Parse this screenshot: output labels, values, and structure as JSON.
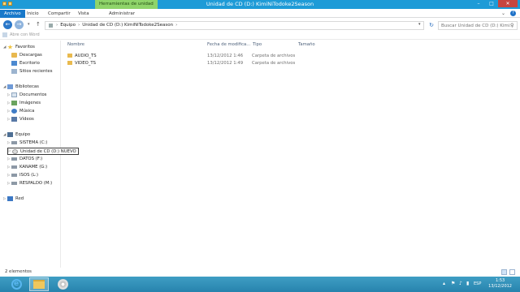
{
  "window": {
    "title": "Unidad de CD (D:) KimiNiTodoke2Season",
    "context_tab": "Herramientas de unidad"
  },
  "ribbon": {
    "tabs": [
      {
        "label": "Archivo",
        "active": true
      },
      {
        "label": "Inicio",
        "active": false
      },
      {
        "label": "Compartir",
        "active": false
      },
      {
        "label": "Vista",
        "active": false
      },
      {
        "label": "Administrar",
        "active": false
      }
    ]
  },
  "address": {
    "crumbs": [
      "Equipo",
      "Unidad de CD (D:) KimiNiTodoke2Season"
    ],
    "search_placeholder": "Buscar Unidad de CD (D:) Kimi..."
  },
  "command_strip": {
    "open_with": "Abre con Word"
  },
  "nav_pane": {
    "favorites": {
      "label": "Favoritos",
      "items": [
        "Descargas",
        "Escritorio",
        "Sitios recientes"
      ]
    },
    "libraries": {
      "label": "Bibliotecas",
      "items": [
        "Documentos",
        "Imágenes",
        "Música",
        "Vídeos"
      ]
    },
    "computer": {
      "label": "Equipo",
      "items": [
        "SISTEMA (C:)",
        "Unidad de CD (D:) NUEVO",
        "DATOS (F:)",
        "KANAME (G:)",
        "ISOS (L:)",
        "RESPALDO (M:)"
      ]
    },
    "network": {
      "label": "Red"
    }
  },
  "content": {
    "columns": [
      "Nombre",
      "Fecha de modifica...",
      "Tipo",
      "Tamaño"
    ],
    "rows": [
      {
        "name": "AUDIO_TS",
        "date": "13/12/2012 1:46",
        "type": "Carpeta de archivos"
      },
      {
        "name": "VIDEO_TS",
        "date": "13/12/2012 1:49",
        "type": "Carpeta de archivos"
      }
    ]
  },
  "status": {
    "count": "2 elementos"
  },
  "taskbar": {
    "language": "ESP",
    "time": "1:53",
    "date": "13/12/2012"
  }
}
